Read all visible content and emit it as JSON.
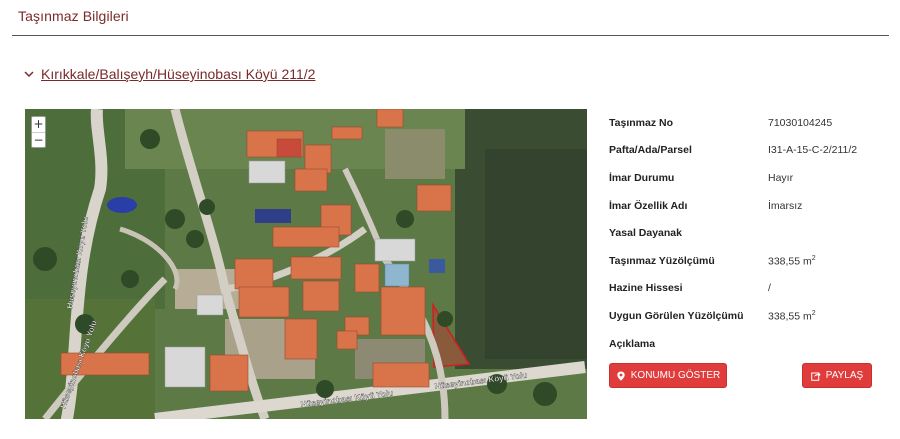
{
  "page": {
    "title": "Taşınmaz Bilgileri"
  },
  "breadcrumb": {
    "link": "Kırıkkale/Balışeyh/Hüseyinobası Köyü 211/2"
  },
  "map": {
    "zoom_in": "+",
    "zoom_out": "−",
    "road_labels": [
      "Hüseyinobası Köyü Yolu",
      "Hüseyinobası Köyü Yolu",
      "Hüseyinobası Köyü Yolu",
      "Hüseyinobası Köyü Yolu"
    ]
  },
  "info": {
    "rows": [
      {
        "label": "Taşınmaz No",
        "value": "71030104245"
      },
      {
        "label": "Pafta/Ada/Parsel",
        "value": "I31-A-15-C-2/211/2"
      },
      {
        "label": "İmar Durumu",
        "value": "Hayır"
      },
      {
        "label": "İmar Özellik Adı",
        "value": "İmarsız"
      },
      {
        "label": "Yasal Dayanak",
        "value": ""
      },
      {
        "label": "Taşınmaz Yüzölçümü",
        "value": "338,55 m",
        "sup": "2"
      },
      {
        "label": "Hazine Hissesi",
        "value": "/"
      },
      {
        "label": "Uygun Görülen Yüzölçümü",
        "value": "338,55 m",
        "sup": "2"
      },
      {
        "label": "Açıklama",
        "value": ""
      }
    ]
  },
  "buttons": {
    "show_location": "KONUMU GÖSTER",
    "share": "PAYLAŞ"
  },
  "colors": {
    "accent": "#7a2a2a",
    "button": "#e03c3c",
    "parcel": "#d02020"
  },
  "icons": [
    "chevron-down-icon",
    "map-marker-icon",
    "share-icon"
  ]
}
